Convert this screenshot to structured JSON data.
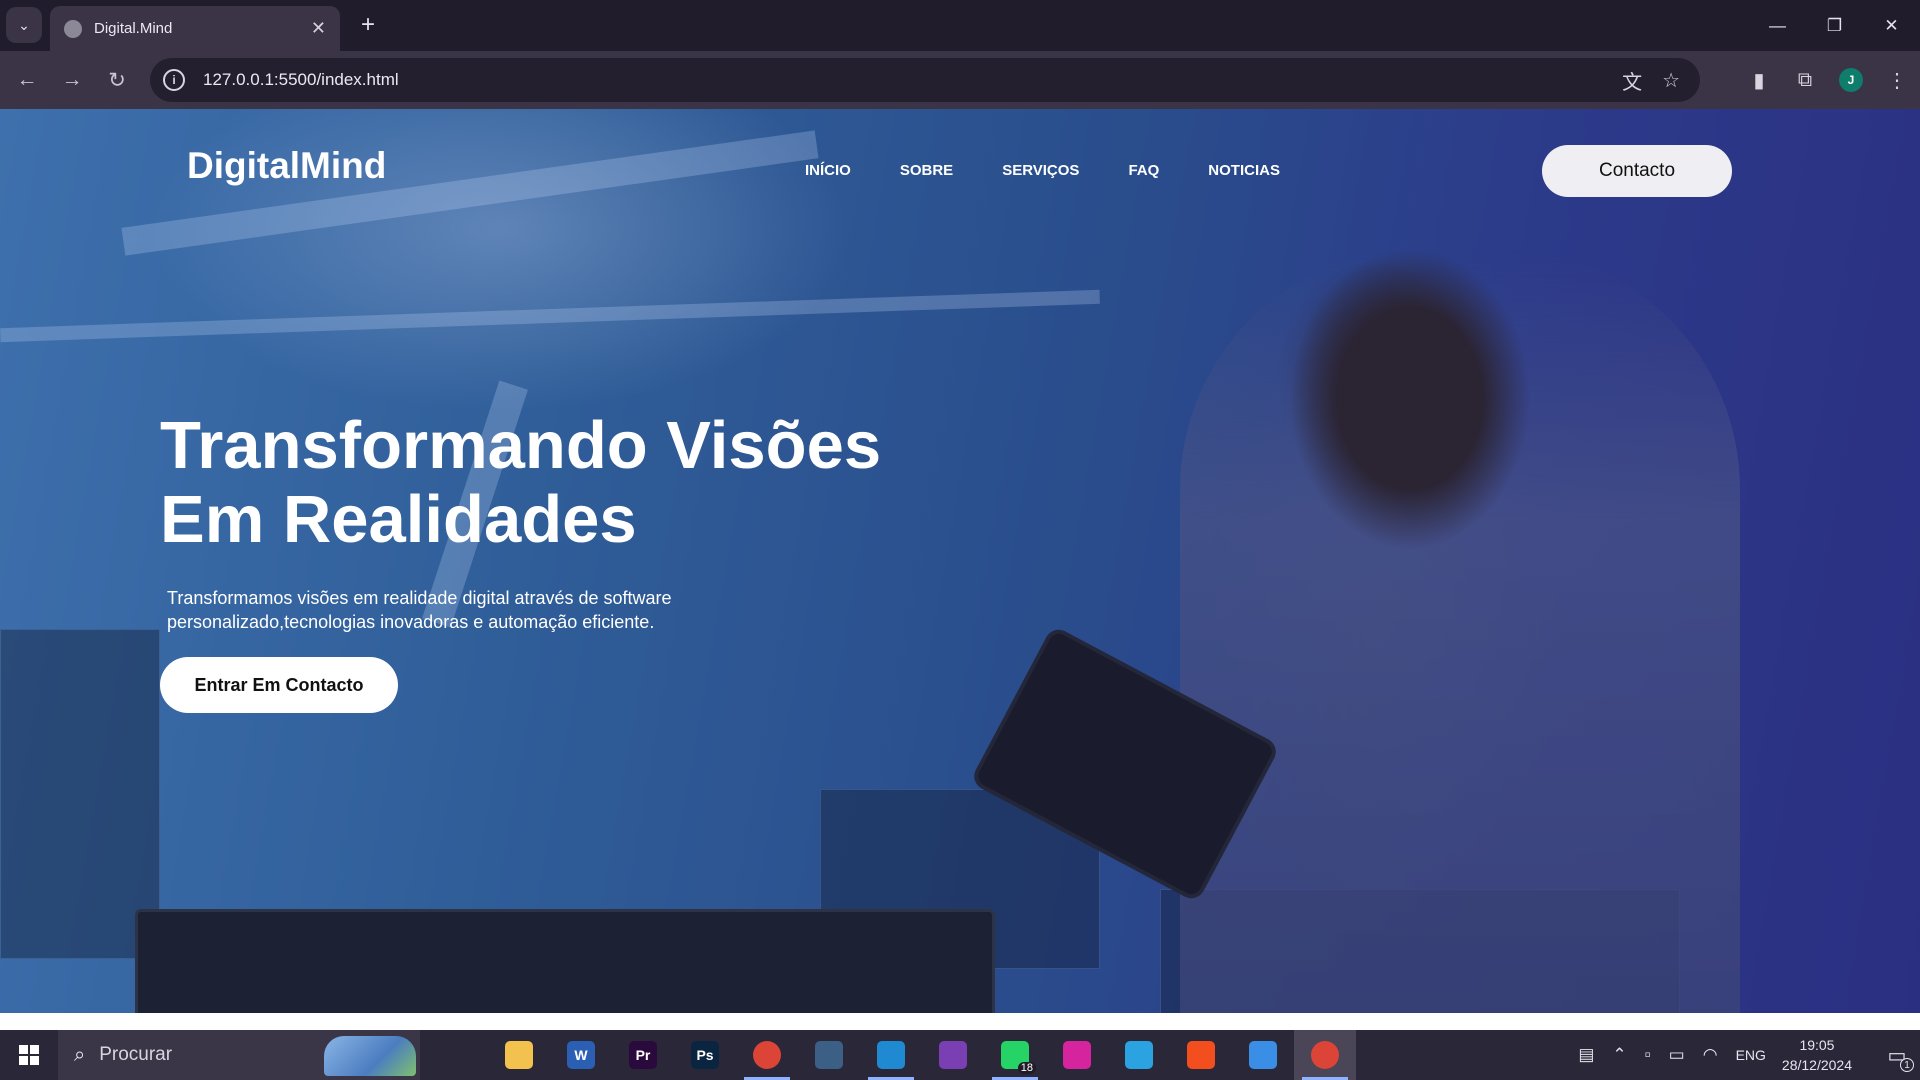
{
  "browser": {
    "tab_title": "Digital.Mind",
    "url": "127.0.0.1:5500/index.html",
    "profile_initial": "J"
  },
  "page": {
    "logo": "DigitalMind",
    "nav": [
      "INÍCIO",
      "SOBRE",
      "SERVIÇOS",
      "FAQ",
      "NOTICIAS"
    ],
    "contact_button": "Contacto",
    "hero_title_line1": "Transformando Visões",
    "hero_title_line2": "Em Realidades",
    "hero_sub_line1": "Transformamos visões em realidade digital através de software",
    "hero_sub_line2": "personalizado,tecnologias inovadoras e automação eficiente.",
    "cta_button": "Entrar Em Contacto"
  },
  "taskbar": {
    "search_placeholder": "Procurar",
    "apps": [
      {
        "name": "task-view",
        "label": "",
        "color": "#2a2738"
      },
      {
        "name": "file-explorer",
        "label": "",
        "color": "#f2c14e"
      },
      {
        "name": "word",
        "label": "W",
        "color": "#2b5fb4"
      },
      {
        "name": "premiere-pro",
        "label": "Pr",
        "color": "#2a0a3c"
      },
      {
        "name": "photoshop",
        "label": "Ps",
        "color": "#0a2540"
      },
      {
        "name": "chrome",
        "label": "",
        "color": "#db4437"
      },
      {
        "name": "sql-workbench",
        "label": "",
        "color": "#3c5f86"
      },
      {
        "name": "vscode",
        "label": "",
        "color": "#1f8ad2"
      },
      {
        "name": "visual-studio",
        "label": "",
        "color": "#7b3fb4"
      },
      {
        "name": "whatsapp",
        "label": "",
        "color": "#25d366"
      },
      {
        "name": "instagram",
        "label": "",
        "color": "#d6249f"
      },
      {
        "name": "telegram",
        "label": "",
        "color": "#2aa3e0"
      },
      {
        "name": "figma",
        "label": "",
        "color": "#f24e1e"
      },
      {
        "name": "photos",
        "label": "",
        "color": "#3a8ee6"
      },
      {
        "name": "chrome-active",
        "label": "",
        "color": "#db4437"
      }
    ],
    "whatsapp_badge": "18",
    "language": "ENG",
    "time": "19:05",
    "date": "28/12/2024",
    "notification_count": "1"
  }
}
